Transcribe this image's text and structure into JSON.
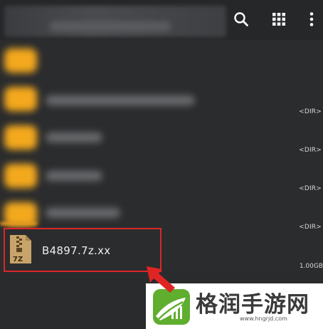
{
  "toolbar": {
    "search_icon": "search-icon",
    "grid_icon": "grid-view-icon",
    "more_icon": "more-vertical-icon"
  },
  "rows": [
    {
      "type": "folder",
      "size": ""
    },
    {
      "type": "folder",
      "size": "<DIR>"
    },
    {
      "type": "folder",
      "size": "<DIR>"
    },
    {
      "type": "folder",
      "size": "<DIR>"
    },
    {
      "type": "folder",
      "size": "<DIR>"
    }
  ],
  "file": {
    "name": "B4897.7z.xx",
    "icon_label": "7Z",
    "size": "1.00GB"
  },
  "watermark": {
    "title": "格润手游网",
    "url": "www.hngrjd.com"
  },
  "colors": {
    "background": "#2b2c2e",
    "folder": "#f3a81d",
    "highlight_border": "#d92828",
    "arrow": "#e02424",
    "archive_icon": "#c9a46a"
  }
}
